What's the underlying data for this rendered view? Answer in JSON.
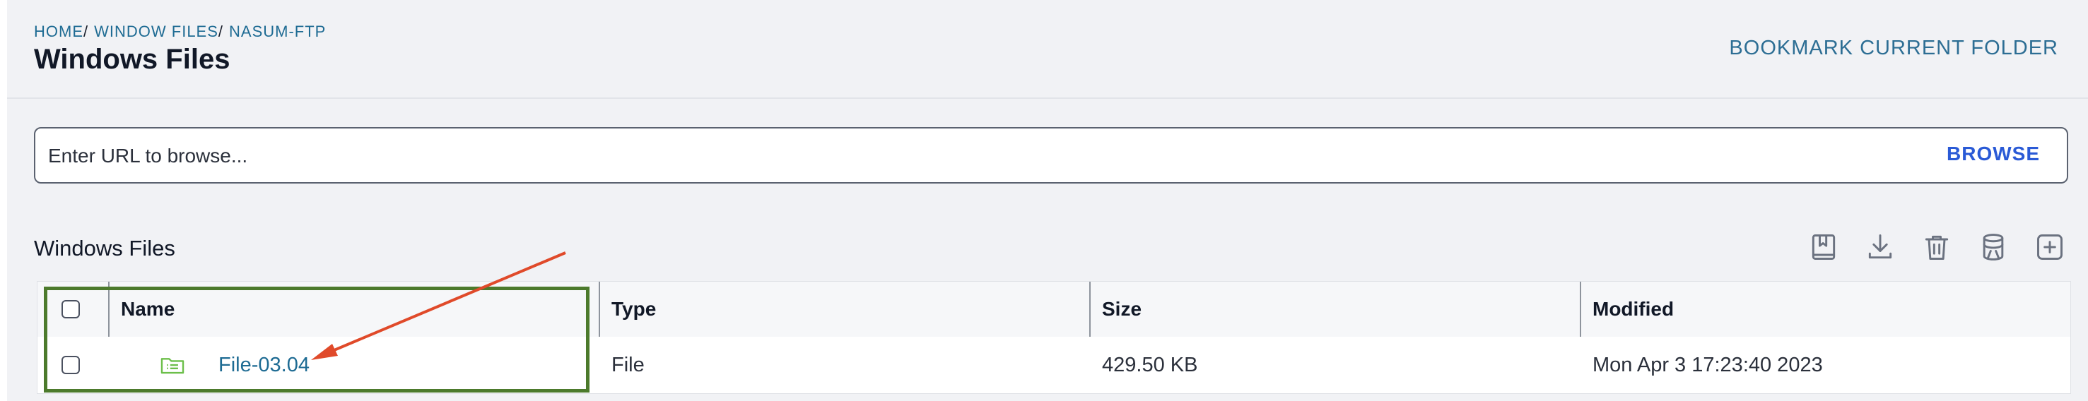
{
  "breadcrumb": [
    {
      "label": "HOME"
    },
    {
      "label": "WINDOW FILES"
    },
    {
      "label": "NASUM-FTP"
    }
  ],
  "breadcrumb_sep": "/",
  "page_title": "Windows Files",
  "bookmark_folder_label": "BOOKMARK CURRENT FOLDER",
  "url_bar": {
    "placeholder": "Enter URL to browse...",
    "value": "",
    "browse_label": "BROWSE"
  },
  "section_title": "Windows Files",
  "toolbar": [
    {
      "icon": "bookmark-icon"
    },
    {
      "icon": "download-icon"
    },
    {
      "icon": "trash-icon"
    },
    {
      "icon": "database-icon"
    },
    {
      "icon": "add-icon"
    }
  ],
  "table": {
    "columns": [
      "Name",
      "Type",
      "Size",
      "Modified"
    ],
    "rows": [
      {
        "name": "File-03.04",
        "type": "File",
        "size": "429.50 KB",
        "modified": "Mon Apr 3 17:23:40 2023",
        "icon": "folder-list-icon"
      }
    ]
  },
  "colors": {
    "link": "#1e6b93",
    "browse": "#2a5ad6",
    "annotation_box": "#4c7a2c",
    "annotation_arrow": "#e04a2a",
    "file_icon": "#6cbf4a"
  }
}
